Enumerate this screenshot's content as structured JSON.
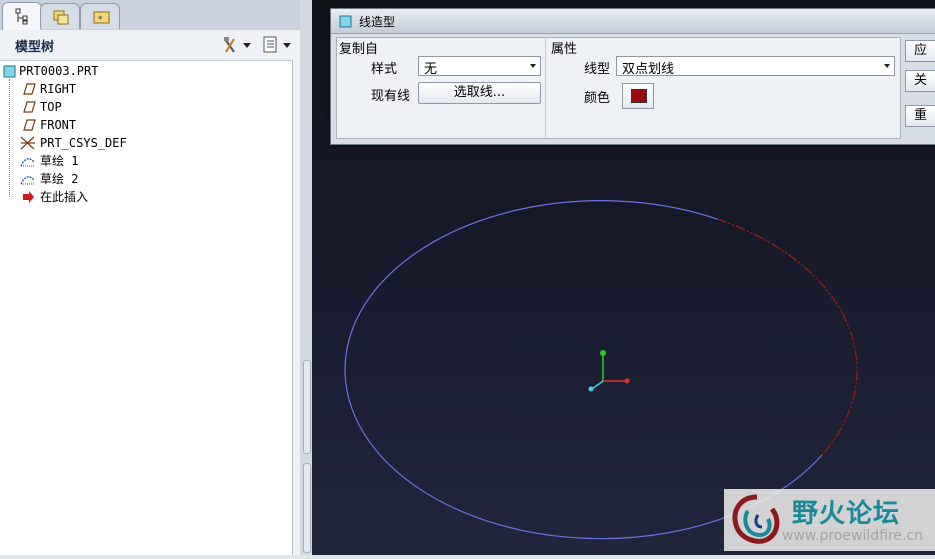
{
  "tree_panel": {
    "title": "模型树",
    "items": [
      {
        "label": "PRT0003.PRT",
        "icon": "part-icon"
      },
      {
        "label": "RIGHT",
        "icon": "datum-plane-icon"
      },
      {
        "label": "TOP",
        "icon": "datum-plane-icon"
      },
      {
        "label": "FRONT",
        "icon": "datum-plane-icon"
      },
      {
        "label": "PRT_CSYS_DEF",
        "icon": "csys-icon"
      },
      {
        "label": "草绘 1",
        "icon": "sketch-icon"
      },
      {
        "label": "草绘 2",
        "icon": "sketch-icon"
      },
      {
        "label": "在此插入",
        "icon": "insert-arrow-icon"
      }
    ]
  },
  "dialog": {
    "title": "线造型",
    "copy_from": {
      "group_label": "复制自",
      "style_label": "样式",
      "style_value": "无",
      "existing_label": "现有线",
      "select_button": "选取线..."
    },
    "properties": {
      "group_label": "属性",
      "linetype_label": "线型",
      "linetype_value": "双点划线",
      "color_label": "颜色",
      "color_value": "#9a0a0a"
    },
    "side_buttons": [
      "应用",
      "关闭",
      "重置"
    ]
  },
  "colors": {
    "curve_blue": "#6b72e0",
    "curve_red": "#a01818",
    "axis_green": "#22cc22",
    "axis_red": "#e03030",
    "axis_cyan": "#3fd0e0"
  },
  "watermark": {
    "title": "野火论坛",
    "url": "www.proewildfire.cn"
  }
}
